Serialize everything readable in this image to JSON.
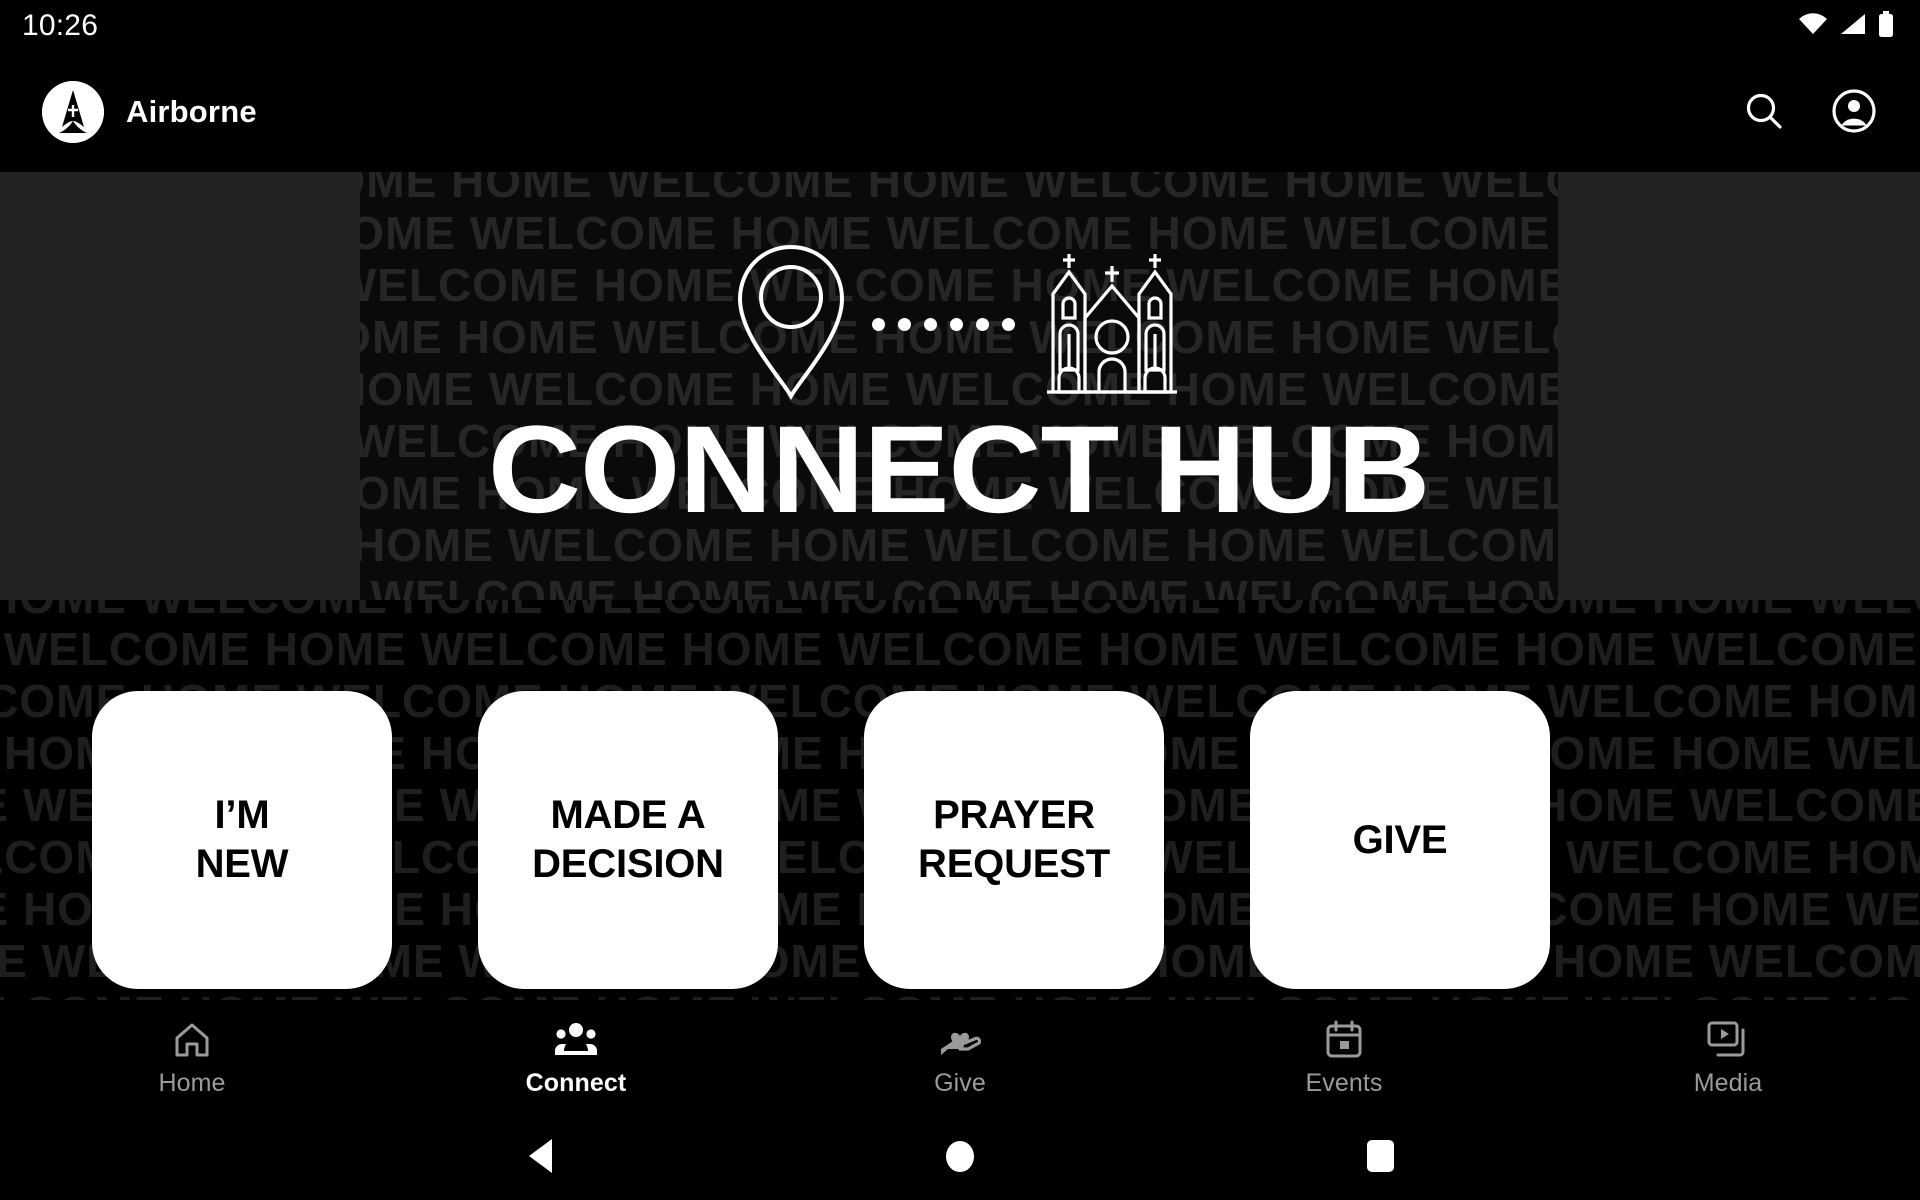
{
  "status_bar": {
    "time": "10:26",
    "icons": [
      "wifi-icon",
      "cellular-signal-icon",
      "battery-icon"
    ]
  },
  "header": {
    "brand_name": "Airborne",
    "logo_icon": "airborne-church-logo-icon",
    "search_icon": "search-icon",
    "account_icon": "account-circle-icon"
  },
  "hero": {
    "title": "CONNECT HUB",
    "left_icon": "location-pin-icon",
    "connector_icon": "dotted-connector-icon",
    "dot_count": 6,
    "right_icon": "church-building-icon",
    "background_text": "WELCOME HOME",
    "background_color": "#0a0a0a",
    "background_text_color": "#262626",
    "side_panel_color": "#222222"
  },
  "background": {
    "pattern_text": "WELCOME HOME WELCOME HOME WELCOME HOME WELCOME HOME WELCOME HOME WELCOME HOME",
    "pattern_color": "#1e1e1e",
    "page_color": "#000000"
  },
  "cards": [
    {
      "label": "I’M\nNEW",
      "name": "im-new"
    },
    {
      "label": "MADE A\nDECISION",
      "name": "made-a-decision"
    },
    {
      "label": "PRAYER\nREQUEST",
      "name": "prayer-request"
    },
    {
      "label": "GIVE",
      "name": "give"
    }
  ],
  "tabbar": {
    "active_index": 1,
    "active_color": "#ffffff",
    "inactive_color": "#9a9a9a",
    "items": [
      {
        "label": "Home",
        "icon": "home-icon",
        "active": false
      },
      {
        "label": "Connect",
        "icon": "people-icon",
        "active": true
      },
      {
        "label": "Give",
        "icon": "hand-heart-icon",
        "active": false
      },
      {
        "label": "Events",
        "icon": "calendar-icon",
        "active": false
      },
      {
        "label": "Media",
        "icon": "video-library-icon",
        "active": false
      }
    ]
  },
  "system_nav": {
    "back": "back-triangle-icon",
    "home": "home-circle-icon",
    "recents": "recents-square-icon"
  }
}
